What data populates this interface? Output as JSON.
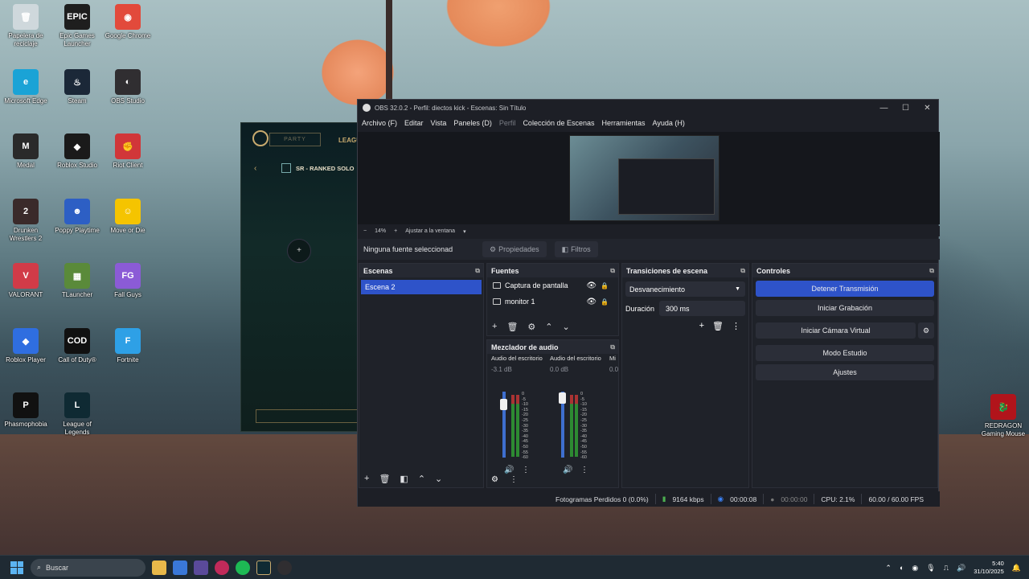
{
  "desktop": {
    "icons": [
      {
        "label": "Papelera de reciclaje",
        "icon": "recycle-bin-icon",
        "color": "#cfd8dc",
        "glyph": "🗑"
      },
      {
        "label": "Epic Games Launcher",
        "icon": "epic-games-icon",
        "color": "#1e1e1e",
        "glyph": "EPIC"
      },
      {
        "label": "Google Chrome",
        "icon": "chrome-icon",
        "color": "#e24a3b",
        "glyph": "◉"
      },
      {
        "label": "Microsoft Edge",
        "icon": "edge-icon",
        "color": "#1aa3d6",
        "glyph": "e"
      },
      {
        "label": "Steam",
        "icon": "steam-icon",
        "color": "#1b2838",
        "glyph": "♨"
      },
      {
        "label": "OBS Studio",
        "icon": "obs-icon",
        "color": "#302e31",
        "glyph": "◐"
      },
      {
        "label": "Medal",
        "icon": "medal-icon",
        "color": "#2a2a2a",
        "glyph": "M"
      },
      {
        "label": "Roblox Studio",
        "icon": "roblox-studio-icon",
        "color": "#1a1a1a",
        "glyph": "◆"
      },
      {
        "label": "Riot Client",
        "icon": "riot-client-icon",
        "color": "#d13639",
        "glyph": "✊"
      },
      {
        "label": "Drunken Wrestlers 2",
        "icon": "drunken-wrestlers-icon",
        "color": "#3a2a2a",
        "glyph": "2"
      },
      {
        "label": "Poppy Playtime",
        "icon": "poppy-playtime-icon",
        "color": "#2d5fc4",
        "glyph": "☻"
      },
      {
        "label": "Move or Die",
        "icon": "move-or-die-icon",
        "color": "#f5c400",
        "glyph": "☺"
      },
      {
        "label": "VALORANT",
        "icon": "valorant-icon",
        "color": "#d13b48",
        "glyph": "V"
      },
      {
        "label": "TLauncher",
        "icon": "tlauncher-icon",
        "color": "#5a8a3a",
        "glyph": "▦"
      },
      {
        "label": "Fall Guys",
        "icon": "fall-guys-icon",
        "color": "#8b5bd6",
        "glyph": "FG"
      },
      {
        "label": "Roblox Player",
        "icon": "roblox-player-icon",
        "color": "#2f6ee0",
        "glyph": "◆"
      },
      {
        "label": "Call of Duty®",
        "icon": "call-of-duty-icon",
        "color": "#111",
        "glyph": "COD"
      },
      {
        "label": "Fortnite",
        "icon": "fortnite-icon",
        "color": "#2ea0e6",
        "glyph": "F"
      },
      {
        "label": "Phasmophobia",
        "icon": "phasmophobia-icon",
        "color": "#111",
        "glyph": "P"
      },
      {
        "label": "League of Legends",
        "icon": "league-of-legends-icon",
        "color": "#0f2a33",
        "glyph": "L"
      },
      {
        "label": "REDRAGON Gaming Mouse",
        "icon": "redragon-icon",
        "color": "#b1141b",
        "glyph": "🐉"
      }
    ]
  },
  "lol_client": {
    "party": "PARTY",
    "nav": "LEAGU",
    "queue": "SR - RANKED SOLO"
  },
  "obs": {
    "title": "OBS 32.0.2 - Perfil: diectos kick - Escenas: Sin Título",
    "menu": [
      "Archivo (F)",
      "Editar",
      "Vista",
      "Paneles (D)",
      "Perfil",
      "Colección de Escenas",
      "Herramientas",
      "Ayuda (H)"
    ],
    "zoom": {
      "minus": "−",
      "value": "14%",
      "plus": "+",
      "fit": "Ajustar a la ventana"
    },
    "source_bar": {
      "none": "Ninguna fuente seleccionad",
      "properties": "Propiedades",
      "filters": "Filtros"
    },
    "scenes": {
      "title": "Escenas",
      "items": [
        "Escena 2"
      ]
    },
    "sources": {
      "title": "Fuentes",
      "items": [
        "Captura de pantalla",
        "monitor 1"
      ]
    },
    "mixer": {
      "title": "Mezclador de audio",
      "channels": [
        {
          "name": "Audio del escritorio",
          "db": "-3.1 dB"
        },
        {
          "name": "Audio del escritorio",
          "db": "0.0 dB"
        },
        {
          "name": "Mi",
          "db": "0.0"
        }
      ],
      "ticks": [
        "0",
        "-5",
        "-10",
        "-15",
        "-20",
        "-25",
        "-30",
        "-35",
        "-40",
        "-45",
        "-50",
        "-55",
        "-60"
      ]
    },
    "transitions": {
      "title": "Transiciones de escena",
      "selected": "Desvanecimiento",
      "duration_label": "Duración",
      "duration_value": "300 ms"
    },
    "controls": {
      "title": "Controles",
      "buttons": [
        "Detener Transmisión",
        "Iniciar Grabación",
        "Iniciar Cámara Virtual",
        "Modo Estudio",
        "Ajustes"
      ]
    },
    "status": {
      "dropped": "Fotogramas Perdidos 0 (0.0%)",
      "bitrate": "9164 kbps",
      "stream_time": "00:00:08",
      "rec_time": "00:00:00",
      "cpu": "CPU: 2.1%",
      "fps": "60.00 / 60.00 FPS"
    }
  },
  "taskbar": {
    "search_placeholder": "Buscar",
    "time": "5:40",
    "date": "31/10/2025"
  },
  "colors": {
    "accent": "#2e53c9",
    "panel": "#1f2229",
    "window": "#1d1f26"
  }
}
